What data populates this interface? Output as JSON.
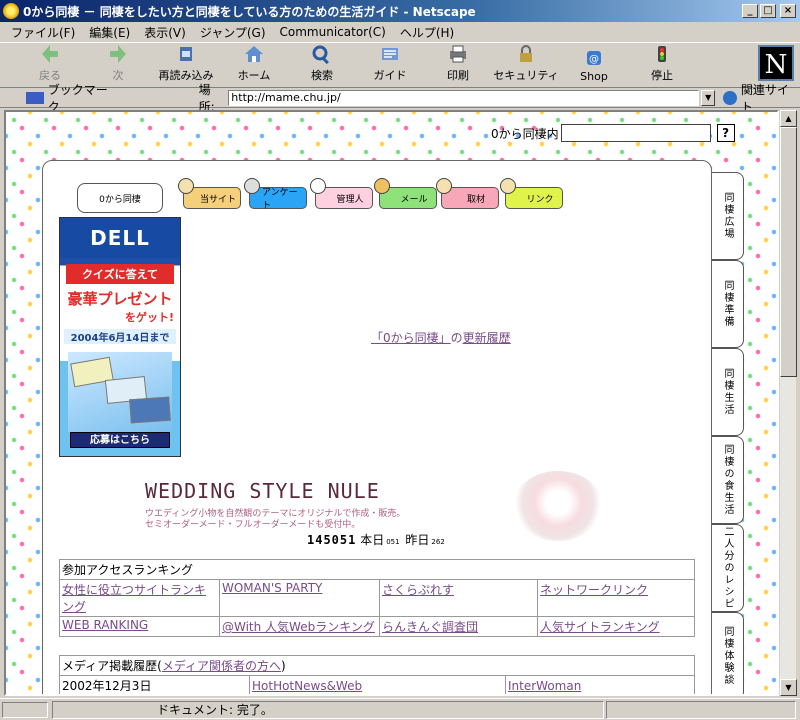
{
  "window": {
    "title": "0から同棲 － 同棲をしたい方と同棲をしている方のための生活ガイド - Netscape"
  },
  "menu": [
    "ファイル(F)",
    "編集(E)",
    "表示(V)",
    "ジャンプ(G)",
    "Communicator(C)",
    "ヘルプ(H)"
  ],
  "toolbar": {
    "back": "戻る",
    "forward": "次",
    "reload": "再読み込み",
    "home": "ホーム",
    "search": "検索",
    "guide": "ガイド",
    "print": "印刷",
    "security": "セキュリティ",
    "shop": "Shop",
    "stop": "停止"
  },
  "location": {
    "bookmark": "ブックマーク",
    "label": "場所:",
    "url": "http://mame.chu.jp/",
    "related": "関連サイト"
  },
  "page": {
    "search_label": "0から同棲内",
    "search_button": "?",
    "logo_text": "0から同棲",
    "nav": [
      "当サイト",
      "アンケート",
      "管理人",
      "メール",
      "取材",
      "リンク"
    ],
    "ad": {
      "brand": "DELL",
      "line1": "クイズに答えて",
      "line2": "豪華プレゼント",
      "line3": "をゲット!",
      "line4": "2004年6月14日まで",
      "apply": "応募はこちら"
    },
    "update": {
      "prefix": "「0から同棲」",
      "mid": "の",
      "link": "更新履歴"
    },
    "wedding": {
      "title": "WEDDING STYLE NULE",
      "desc1": "ウエディング小物を自然観のテーマにオリジナルで作成・販売。",
      "desc2": "セミオーダーメード・フルオーダーメードも受付中。"
    },
    "counter": {
      "total": "145051",
      "today_label": "本日",
      "today": "051",
      "yesterday_label": "昨日",
      "yesterday": "262"
    },
    "ranking": {
      "title": "参加アクセスランキング",
      "rows": [
        [
          "女性に役立つサイトランキング",
          "WOMAN'S PARTY",
          "さくらぷれす",
          "ネットワークリンク"
        ],
        [
          "WEB RANKING",
          "@With 人気Webランキング",
          "らんきんぐ調査団",
          "人気サイトランキング"
        ]
      ]
    },
    "media": {
      "title_prefix": "メディア掲載履歴(",
      "title_link": "メディア関係者の方へ",
      "title_suffix": ")",
      "row": [
        "2002年12月3日",
        "HotHotNews&Web",
        "InterWoman"
      ]
    },
    "side_tabs": [
      "同棲広場",
      "同棲準備",
      "同棲生活",
      "同棲の食生活",
      "二人分のレシピ",
      "同棲体験談"
    ]
  },
  "status": {
    "text": "ドキュメント: 完了。"
  }
}
